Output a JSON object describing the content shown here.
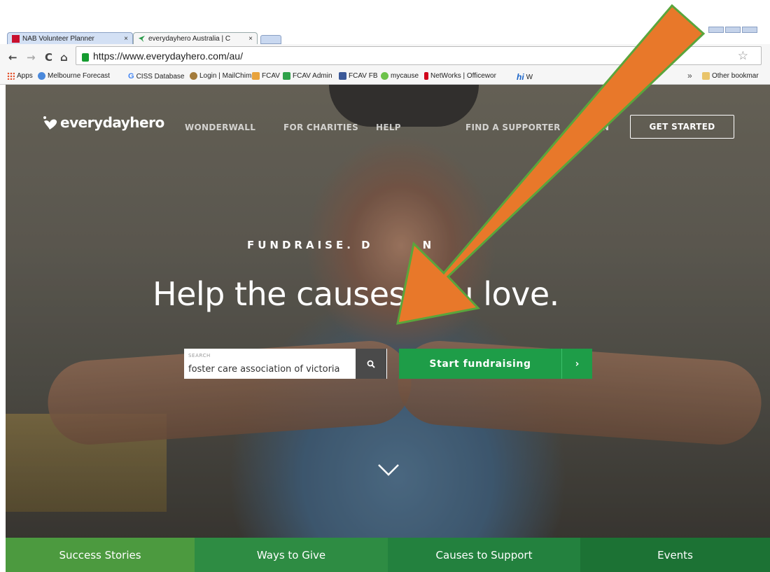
{
  "browser": {
    "tabs": [
      {
        "label": "NAB Volunteer Planner",
        "close": "×"
      },
      {
        "label": "everydayhero Australia | C",
        "close": "×"
      }
    ],
    "nav": {
      "back": "←",
      "forward": "→",
      "reload": "C",
      "home": "⌂"
    },
    "url": "https://www.everydayhero.com/au/",
    "bookmark_star": "☆",
    "bookmarks": [
      {
        "label": "Apps",
        "color": "#e44d26"
      },
      {
        "label": "Melbourne Forecast",
        "color": "#4a89dc"
      },
      {
        "label": "CISS Database",
        "color": "#4285f4"
      },
      {
        "label": "Login | MailChimp",
        "color": "#a37b3b"
      },
      {
        "label": "FCAV",
        "color": "#e8a33d"
      },
      {
        "label": "FCAV Admin",
        "color": "#2fa24a"
      },
      {
        "label": "FCAV FB",
        "color": "#3b5998"
      },
      {
        "label": "mycause",
        "color": "#6cc24a"
      },
      {
        "label": "NetWorks | Officewor",
        "color": "#d0021b"
      },
      {
        "label": "W",
        "color": "#1a64c8"
      }
    ],
    "bookmarks_overflow": "»",
    "other_bookmarks": "Other bookmar"
  },
  "site": {
    "logo_text": "everydayhero",
    "nav": {
      "wonderwall": "WONDERWALL",
      "for_charities": "FOR CHARITIES",
      "help": "HELP",
      "find_supporter": "FIND A SUPPORTER",
      "login": "N",
      "get_started": "GET STARTED"
    },
    "hero": {
      "tagline_part1": "FUNDRAISE. D",
      "tagline_part2": "N",
      "headline": "Help the causes you love."
    },
    "search": {
      "label": "SEARCH",
      "value": "foster care association of victoria"
    },
    "cta": {
      "label": "Start fundraising",
      "chevron": "›"
    },
    "categories": [
      {
        "label": "Success Stories",
        "color": "#4c9a3f"
      },
      {
        "label": "Ways to Give",
        "color": "#2e8c43"
      },
      {
        "label": "Causes to Support",
        "color": "#23813e"
      },
      {
        "label": "Events",
        "color": "#1c7234"
      }
    ]
  },
  "annotation": {
    "arrow_color": "#e8782a",
    "arrow_outline": "#5aa53c"
  }
}
